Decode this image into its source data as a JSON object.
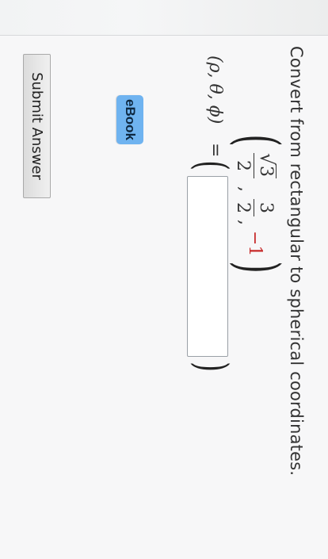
{
  "question": {
    "text": "Convert from rectangular to spherical coordinates."
  },
  "point": {
    "x_num_radicand": "3",
    "x_den": "2",
    "y_num": "3",
    "y_den": "2",
    "z": "−1",
    "negative_color": "#c62828"
  },
  "answer": {
    "lhs": "(ρ, θ, ϕ)",
    "equals": "=",
    "input_value": ""
  },
  "buttons": {
    "ebook_label": "eBook",
    "submit_label": "Submit Answer"
  },
  "colors": {
    "ebook_bg": "#6fb3f0"
  }
}
